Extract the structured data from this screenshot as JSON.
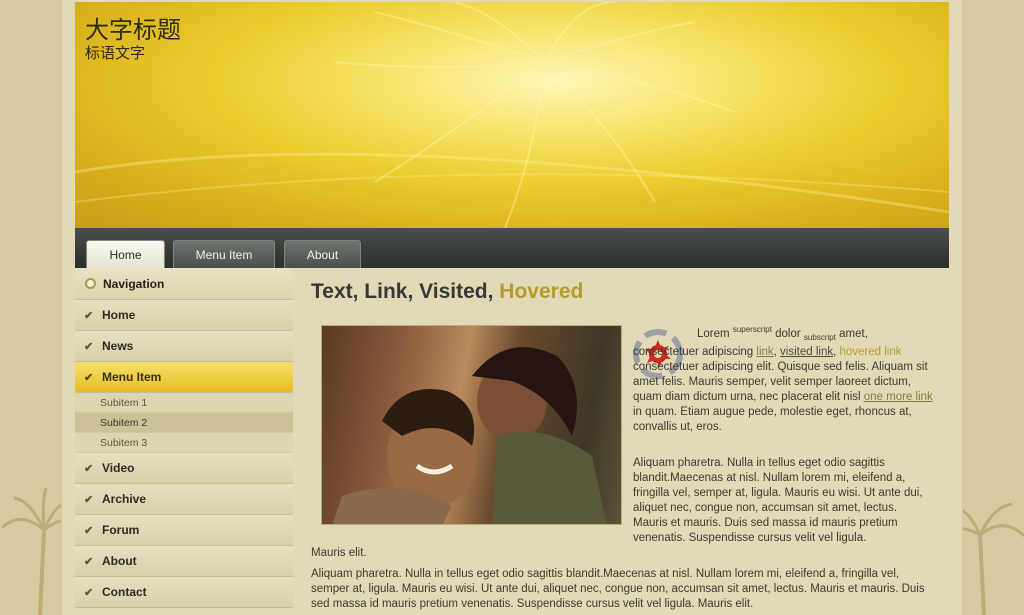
{
  "header": {
    "title": "大字标题",
    "slogan": "标语文字"
  },
  "nav": {
    "tabs": [
      {
        "label": "Home",
        "active": true
      },
      {
        "label": "Menu Item",
        "active": false
      },
      {
        "label": "About",
        "active": false
      }
    ]
  },
  "sidebar": {
    "title": "Navigation",
    "items": [
      {
        "label": "Home"
      },
      {
        "label": "News"
      },
      {
        "label": "Menu Item",
        "active": true
      },
      {
        "label": "Video"
      },
      {
        "label": "Archive"
      },
      {
        "label": "Forum"
      },
      {
        "label": "About"
      },
      {
        "label": "Contact"
      }
    ],
    "subitems": [
      "Subitem 1",
      "Subitem 2",
      "Subitem 3"
    ]
  },
  "content": {
    "title_text": "Text",
    "title_link": "Link",
    "title_visited": "Visited",
    "title_hovered": "Hovered",
    "p1_lorem": "Lorem",
    "p1_sup": "superscript",
    "p1_dolor": "dolor",
    "p1_sub": "subscript",
    "p1_amet": "amet, consectetuer adipiscing",
    "p1_link": "link",
    "p1_visited": "visited link",
    "p1_hovered": "hovered link",
    "p1_rest": "consectetuer adipiscing elit. Quisque sed felis. Aliquam sit amet felis. Mauris semper, velit semper laoreet dictum, quam diam dictum urna, nec placerat elit nisl",
    "p1_more": "one more link",
    "p1_end": "in quam. Etiam augue pede, molestie eget, rhoncus at, convallis ut, eros.",
    "p2": "Aliquam pharetra. Nulla in tellus eget odio sagittis blandit.Maecenas at nisl. Nullam lorem mi, eleifend a, fringilla vel, semper at, ligula. Mauris eu wisi. Ut ante dui, aliquet nec, congue non, accumsan sit amet, lectus. Mauris et mauris. Duis sed massa id mauris pretium venenatis. Suspendisse cursus velit vel ligula.",
    "p3": "Mauris elit.",
    "p4": "Aliquam pharetra. Nulla in tellus eget odio sagittis blandit.Maecenas at nisl. Nullam lorem mi, eleifend a, fringilla vel, semper at, ligula. Mauris eu wisi. Ut ante dui, aliquet nec, congue non, accumsan sit amet, lectus. Mauris et mauris. Duis sed massa id mauris pretium venenatis. Suspendisse cursus velit vel ligula. Mauris elit."
  },
  "colors": {
    "accent": "#e5bf22",
    "hovered": "#b49a2f",
    "nav_bg": "#2c302d"
  }
}
